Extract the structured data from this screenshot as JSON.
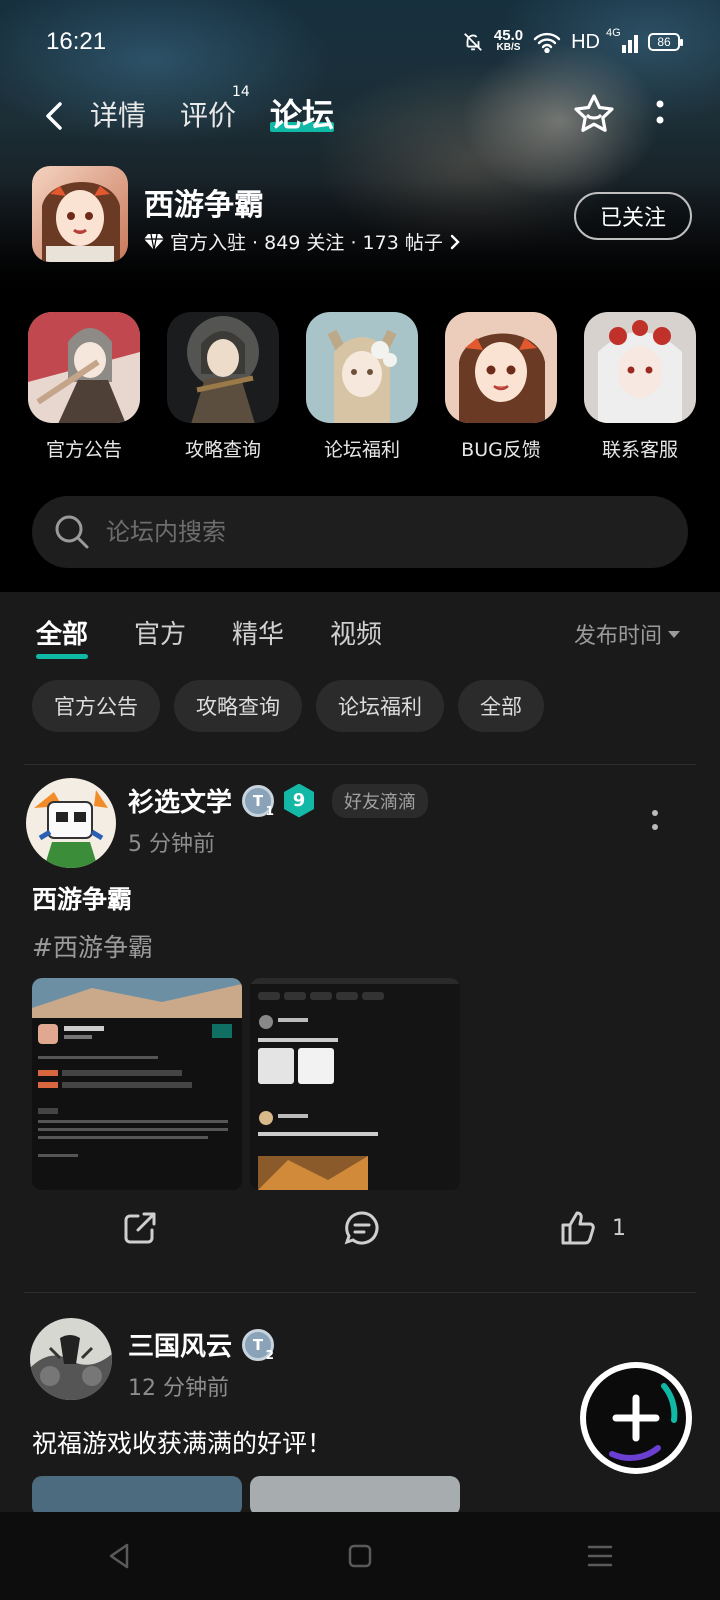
{
  "status_bar": {
    "time": "16:21",
    "net_speed_value": "45.0",
    "net_speed_unit": "KB/S",
    "hd": "HD",
    "signal": "4G",
    "battery": "86"
  },
  "nav": {
    "tabs": [
      {
        "label": "详情"
      },
      {
        "label": "评价",
        "count": "14"
      },
      {
        "label": "论坛",
        "active": true
      }
    ]
  },
  "game": {
    "name": "西游争霸",
    "meta": "官方入驻 · 849 关注 · 173 帖子",
    "follow_label": "已关注"
  },
  "shortcuts": [
    {
      "label": "官方公告"
    },
    {
      "label": "攻略查询"
    },
    {
      "label": "论坛福利"
    },
    {
      "label": "BUG反馈"
    },
    {
      "label": "联系客服"
    }
  ],
  "search": {
    "placeholder": "论坛内搜索"
  },
  "filter_tabs": [
    {
      "label": "全部",
      "active": true
    },
    {
      "label": "官方"
    },
    {
      "label": "精华"
    },
    {
      "label": "视频"
    }
  ],
  "sort_label": "发布时间",
  "chips": [
    "官方公告",
    "攻略查询",
    "论坛福利",
    "全部"
  ],
  "posts": [
    {
      "username": "衫选文学",
      "level": "T",
      "level_sub": "1",
      "badge": "9",
      "tag": "好友滴滴",
      "time": "5 分钟前",
      "title": "西游争霸",
      "topic": "#西游争霸",
      "like_count": "1"
    },
    {
      "username": "三国风云",
      "level": "T",
      "level_sub": "2",
      "time": "12 分钟前",
      "title": "祝福游戏收获满满的好评！"
    }
  ],
  "colors": {
    "accent": "#10b8a6",
    "background": "#000000",
    "card": "#1a1a1a",
    "chip": "#2b2b2b"
  },
  "icons": {
    "back": "chevron-left-icon",
    "star": "star-icon",
    "more": "more-vertical-icon",
    "search": "search-icon",
    "share": "share-icon",
    "comment": "comment-icon",
    "like": "thumbs-up-icon",
    "add": "plus-icon"
  }
}
